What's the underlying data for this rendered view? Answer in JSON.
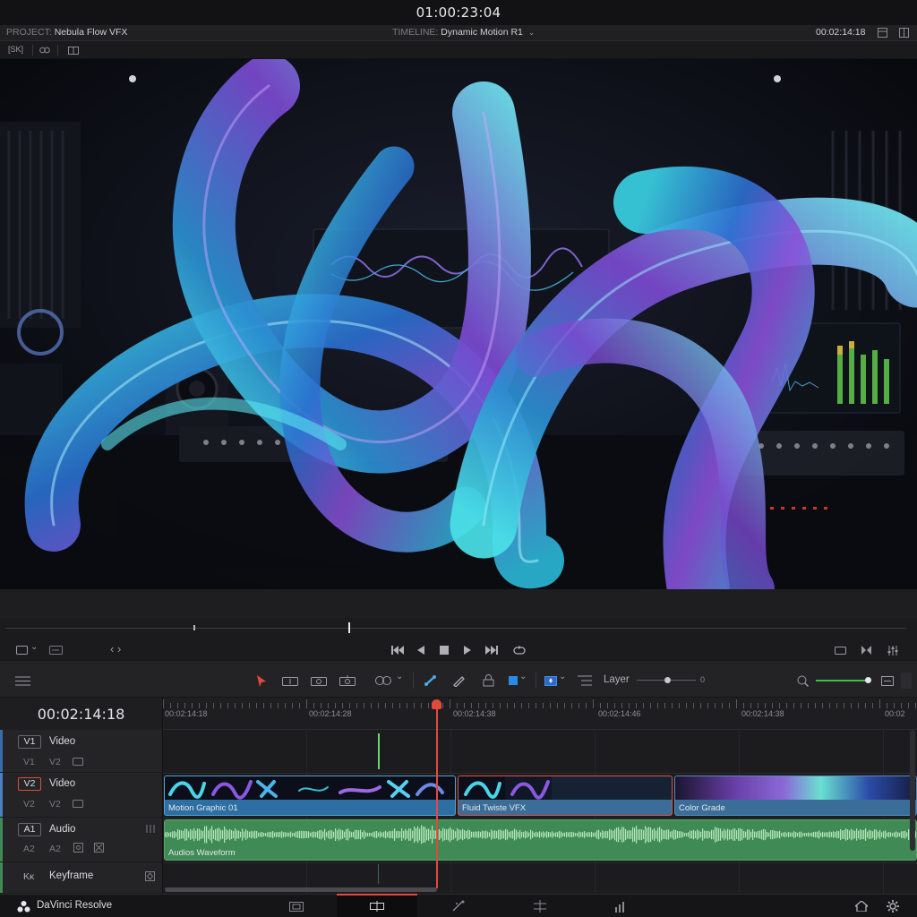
{
  "timecode_top": "01:00:23:04",
  "project": {
    "label": "PROJECT:",
    "name": "Nebula Flow VFX"
  },
  "timeline": {
    "label": "TIMELINE:",
    "name": "Dynamic Motion R1"
  },
  "header_timecode": "00:02:14:18",
  "viewer_tools": {
    "badge": "[SK]"
  },
  "edit_tools": {
    "layer_label": "Layer",
    "layer_value": "0"
  },
  "timeline_view": {
    "timecode": "00:02:14:18",
    "ruler_labels": [
      "00:02:14:18",
      "00:02:14:28",
      "00:02:14:38",
      "00:02:14:46",
      "00:02:14:38",
      "00:02"
    ]
  },
  "tracks": [
    {
      "tag": "V1",
      "name": "Video",
      "sub_tag": "V1",
      "sub_name": "V2"
    },
    {
      "tag": "V2",
      "name": "Video",
      "sub_tag": "V2",
      "sub_name": "V2"
    },
    {
      "tag": "A1",
      "name": "Audio",
      "sub_tag": "A2",
      "sub_name": "A2"
    },
    {
      "tag": "Kĸ",
      "name": "Keyframe"
    }
  ],
  "clips": {
    "motion": "Motion Graphic 01",
    "fluid": "Fluid Twiste VFX",
    "grade": "Color Grade",
    "audio": "Audios Waveform"
  },
  "app_name": "DaVinci Resolve",
  "colors": {
    "accent": "#e24a3c",
    "video_clip": "#3a7fb0",
    "audio_clip": "#3f8a55",
    "track_stripe": "#4a7fc0"
  }
}
